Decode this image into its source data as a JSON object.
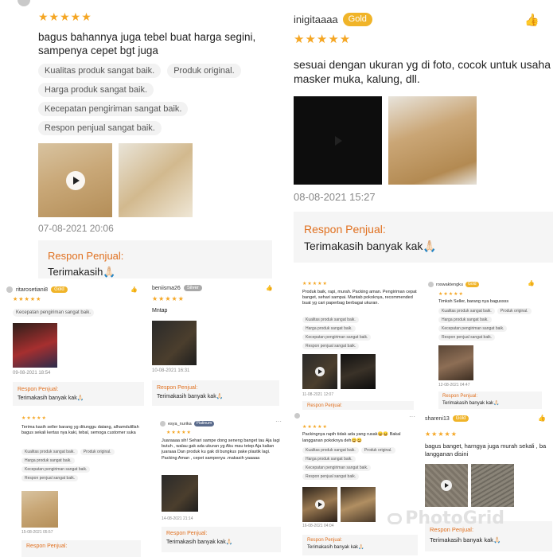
{
  "top_left": {
    "stars": "★★★★★",
    "review": "bagus bahannya juga tebel buat harga segini, sampenya cepet bgt juga",
    "chips": [
      "Kualitas produk sangat baik.",
      "Produk original.",
      "Harga produk sangat baik.",
      "Kecepatan pengiriman sangat baik.",
      "Respon penjual sangat baik."
    ],
    "date": "07-08-2021 20:06",
    "reply_title": "Respon Penjual:",
    "reply_text": "Terimakasih🙏🏻"
  },
  "top_right": {
    "username": "inigitaaaa",
    "badge": "Gold",
    "stars": "★★★★★",
    "review": "sesuai dengan ukuran yg di foto, cocok untuk usaha masker muka, kalung, dll.",
    "date": "08-08-2021 15:27",
    "reply_title": "Respon Penjual:",
    "reply_text": "Terimakasih banyak kak🙏🏻"
  },
  "mid_a": {
    "username": "ritarosetiani8",
    "badge": "Gold",
    "stars": "★★★★★",
    "chips": [
      "Kecepatan pengiriman sangat baik."
    ],
    "date": "09-08-2021 18:54",
    "reply_title": "Respon Penjual:",
    "reply_text": "Terimakasih banyak kak🙏🏻"
  },
  "mid_b": {
    "username": "beniisma26",
    "badge": "Silver",
    "stars": "★★★★★",
    "review": "Mntap",
    "date": "10-08-2021 16:31",
    "reply_title": "Respon Penjual:",
    "reply_text": "Terimakasih banyak kak🙏🏻"
  },
  "mid_c": {
    "stars": "★★★★★",
    "review": "Produk baik, rapi, murah. Packing aman. Pengiriman cepat banget, sehari sampai. Mantab pokoknya, recommended buat yg cari paperbag berbagai ukuran.",
    "chips": [
      "Kualitas produk sangat baik.",
      "Harga produk sangat baik.",
      "Kecepatan pengiriman sangat baik.",
      "Respon penjual sangat baik."
    ],
    "date": "11-08-2021 12:07",
    "reply_title": "Respon Penjual:"
  },
  "mid_d": {
    "username": "roswaktengku",
    "badge": "Gold",
    "stars": "★★★★★",
    "review": "Timksh Seller, barang nya bagussss",
    "chips": [
      "Kualitas produk sangat baik.",
      "Produk original.",
      "Harga produk sangat baik.",
      "Kecepatan pengiriman sangat baik.",
      "Respon penjual sangat baik."
    ],
    "date": "12-08-2021 04:47",
    "reply_title": "Respon Penjual:",
    "reply_text": "Terimakasih banyak kak🙏🏻"
  },
  "bot_a": {
    "stars": "★★★★★",
    "review": "Terima kasih seller barang yg ditunggu datang, alhamdulillah bagus sekali kertas nya kaki, tebal, semoga customer suka",
    "chips": [
      "Kualitas produk sangat baik.",
      "Produk original.",
      "Harga produk sangat baik.",
      "Kecepatan pengiriman sangat baik.",
      "Respon penjual sangat baik."
    ],
    "date": "15-08-2021 05:57",
    "reply_title": "Respon Penjual:"
  },
  "bot_b": {
    "username": "esya_nurika",
    "badge": "Platinum",
    "stars": "★★★★★",
    "review": "Juaraaaa sih! Sehari sampe dong seneng banget tau Aja lagi butuh , walau gak ada ukuran yg Aku mau tetep Aja kalian juaraaa Dan produk ku gak di bungkus pake plastik lagi. Packing Aman , cepet sampenya .makasih yaaaaa",
    "date": "14-08-2021 21:14",
    "reply_title": "Respon Penjual:",
    "reply_text": "Terimakasih banyak kak🙏🏻"
  },
  "bot_c": {
    "stars": "★★★★★",
    "review": "Packingnya rapih tidak ada yang rusak😄😄 Bakal langganan pokoknya deh😄😄",
    "chips": [
      "Kualitas produk sangat baik.",
      "Produk original.",
      "Harga produk sangat baik.",
      "Kecepatan pengiriman sangat baik.",
      "Respon penjual sangat baik."
    ],
    "date": "16-08-2021 04:04",
    "reply_title": "Respon Penjual:",
    "reply_text": "Terimakasih banyak kak🙏🏻"
  },
  "bot_d": {
    "username": "shareni13",
    "badge": "Gold",
    "stars": "★★★★★",
    "review": "bagus banget, harngya juga murah sekali , ba langganan disini",
    "reply_title": "Respon Penjual:",
    "reply_text": "Terimakasih banyak kak🙏🏻"
  },
  "watermark": "PhotoGrid",
  "icons": {
    "like": "thumbs-up-icon",
    "play": "play-icon",
    "more": "more-icon"
  },
  "colors": {
    "star": "#f5a623",
    "reply_title": "#e0701f",
    "badge_gold": "#f0b429"
  }
}
